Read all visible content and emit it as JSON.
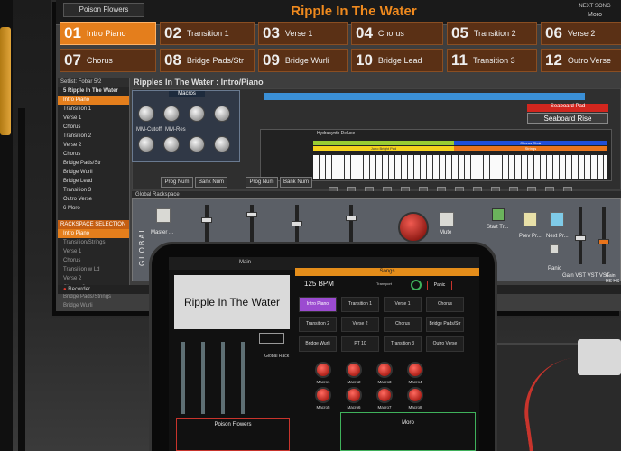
{
  "app": {
    "title": "Ripple In The Water",
    "prev_song": "Poison Flowers",
    "next_song_label": "NEXT SONG",
    "next_song": "Moro"
  },
  "song_parts": [
    {
      "num": "01",
      "name": "Intro Piano",
      "active": true
    },
    {
      "num": "02",
      "name": "Transition 1",
      "active": false
    },
    {
      "num": "03",
      "name": "Verse 1",
      "active": false
    },
    {
      "num": "04",
      "name": "Chorus",
      "active": false
    },
    {
      "num": "05",
      "name": "Transition 2",
      "active": false
    },
    {
      "num": "06",
      "name": "Verse 2",
      "active": false
    },
    {
      "num": "07",
      "name": "Chorus",
      "active": false
    },
    {
      "num": "08",
      "name": "Bridge Pads/Str",
      "active": false
    },
    {
      "num": "09",
      "name": "Bridge Wurli",
      "active": false
    },
    {
      "num": "10",
      "name": "Bridge Lead",
      "active": false
    },
    {
      "num": "11",
      "name": "Transition 3",
      "active": false
    },
    {
      "num": "12",
      "name": "Outro Verse",
      "active": false
    }
  ],
  "setlist": {
    "label": "Setlist:",
    "name": "Fobar 5/2",
    "song_header": "5 Ripple In The Water",
    "items": [
      "Intro Piano",
      "Transition 1",
      "Verse 1",
      "Chorus",
      "Transition 2",
      "Verse 2",
      "Chorus",
      "Bridge Pads/Str",
      "Bridge Wurli",
      "Bridge Lead",
      "Transition 3",
      "Outro Verse"
    ],
    "next_song": "6 Moro"
  },
  "rackspace_selection": {
    "header": "RACKSPACE SELECTION",
    "items": [
      "Intro Piano",
      "Transition/Strings",
      "Verse 1",
      "Chorus",
      "Transition w Ld",
      "Verse 2",
      "Chorus 2",
      "Bridge Pads/Strings",
      "Bridge Wurli"
    ]
  },
  "rack": {
    "title": "Ripples In The Water : Intro/Piano",
    "macros_label": "Macros",
    "cutoff_label": "MM-Cutoff",
    "res_label": "MM-Res",
    "seaboard_pad": "Seaboard Pad",
    "seaboard_rise": "Seaboard Rise",
    "synth_name": "Hydrasynth Deluxe",
    "zone_top": "Chorus Choir",
    "zone_mid": "Juno Bright Pad",
    "zone_right": "Strings",
    "prog_num": "Prog Num",
    "bank_num": "Bank Num",
    "global_rackspace": "Global Rackspace",
    "global_label": "GLOBAL",
    "master_label": "Master ...",
    "mute_label": "Mute",
    "start_label": "Start Tr...",
    "prev_label": "Prev Pr...",
    "next_label": "Next Pr...",
    "panic_label": "Panic",
    "gain_vst1": "Gain VST",
    "vst1": "VST",
    "vst2": "VST",
    "gain_hs": "Gain HS",
    "hs": "HS",
    "knob_value": "102",
    "recorder": "Recorder"
  },
  "tablet": {
    "tab_main": "Main",
    "tab_songs": "Songs",
    "song_title": "Ripple In The Water",
    "bpm": "125 BPM",
    "transport": "Transport",
    "panic": "Panic",
    "global_rack": "Global Rack",
    "parts": [
      "Intro Piano",
      "Transition 1",
      "Verse 1",
      "Chorus",
      "Transition 2",
      "Verse 2",
      "Chorus",
      "Bridge Pads/Str",
      "Bridge Wurli",
      "PT 10",
      "Transition 3",
      "Outro Verse"
    ],
    "macros": [
      "Macro1",
      "Macro2",
      "Macro3",
      "Macro4",
      "Macro5",
      "Macro6",
      "Macro7",
      "Macro8"
    ],
    "prev_song": "Poison Flowers",
    "next_song": "Moro"
  }
}
